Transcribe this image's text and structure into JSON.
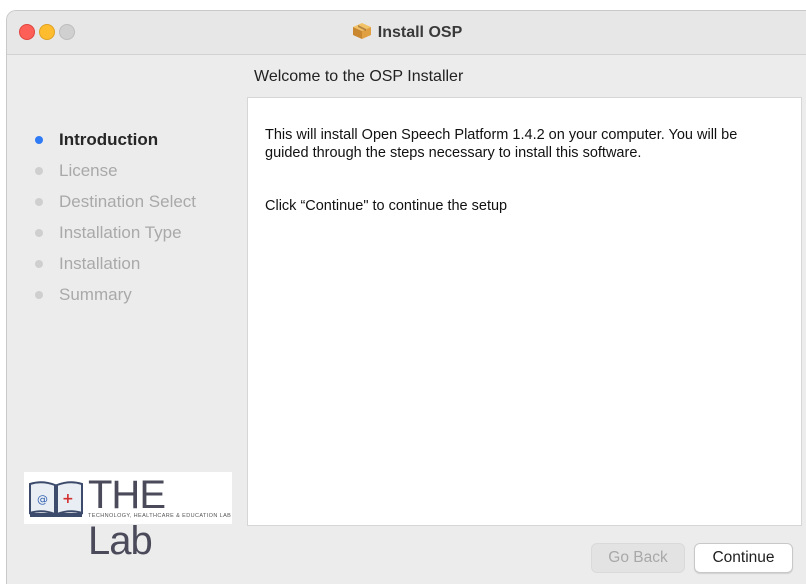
{
  "window": {
    "title": "Install OSP",
    "title_icon": "package-icon"
  },
  "subtitle": "Welcome to the OSP Installer",
  "steps": [
    {
      "label": "Introduction",
      "active": true
    },
    {
      "label": "License",
      "active": false
    },
    {
      "label": "Destination Select",
      "active": false
    },
    {
      "label": "Installation Type",
      "active": false
    },
    {
      "label": "Installation",
      "active": false
    },
    {
      "label": "Summary",
      "active": false
    }
  ],
  "content": {
    "paragraph1": "This will install Open Speech Platform 1.4.2 on your computer. You will be guided through the steps necessary to install this software.",
    "paragraph2": "Click “Continue\" to continue the setup"
  },
  "logo": {
    "name": "THE Lab",
    "tagline": "TECHNOLOGY, HEALTHCARE & EDUCATION LAB"
  },
  "buttons": {
    "back": "Go Back",
    "continue": "Continue"
  },
  "colors": {
    "accent": "#2f7bf5",
    "close": "#fe5f57",
    "minimize": "#febc2e",
    "maximize_disabled": "#d0d0d0"
  }
}
